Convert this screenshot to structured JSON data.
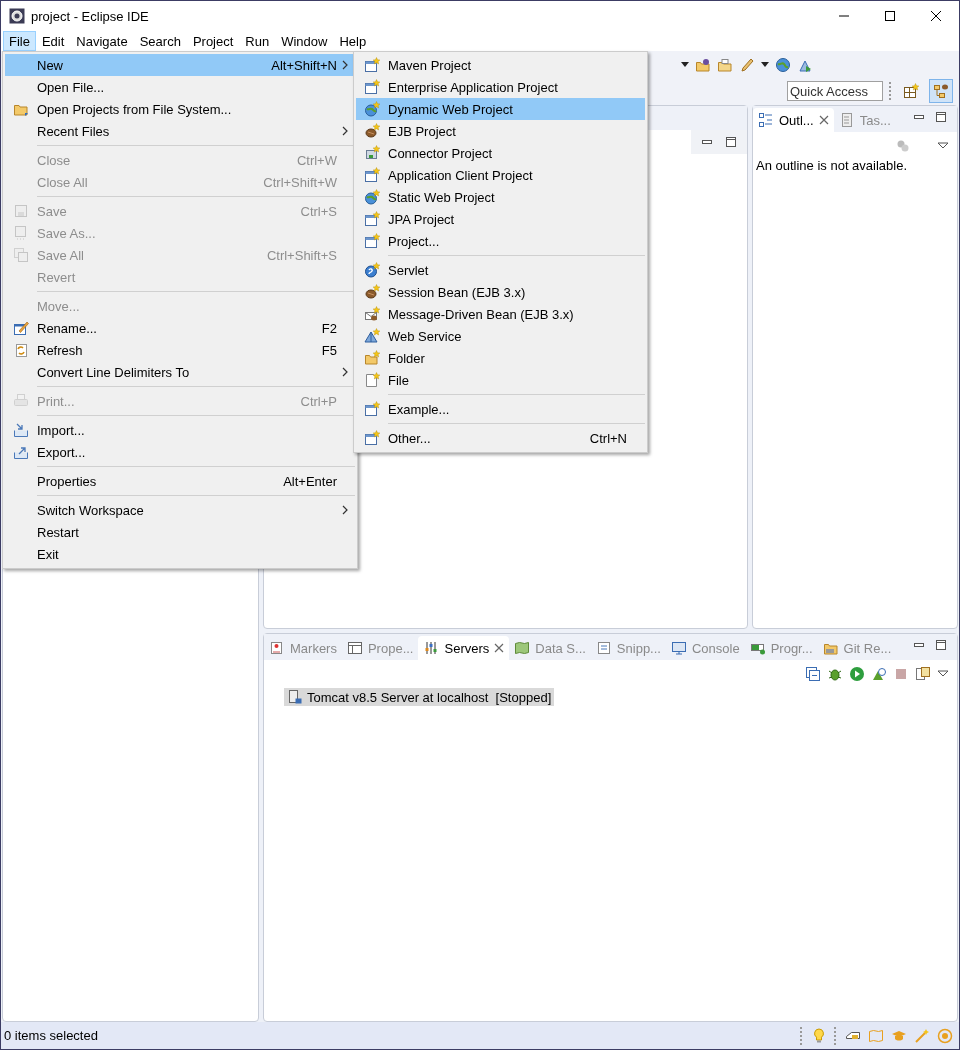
{
  "window": {
    "title": "project - Eclipse IDE"
  },
  "menubar": [
    {
      "label": "File",
      "selected": true
    },
    {
      "label": "Edit",
      "selected": false
    },
    {
      "label": "Navigate",
      "selected": false
    },
    {
      "label": "Search",
      "selected": false
    },
    {
      "label": "Project",
      "selected": false
    },
    {
      "label": "Run",
      "selected": false
    },
    {
      "label": "Window",
      "selected": false
    },
    {
      "label": "Help",
      "selected": false
    }
  ],
  "quick_access": {
    "placeholder": "Quick Access"
  },
  "file_menu": [
    {
      "kind": "item",
      "label": "New",
      "shortcut": "Alt+Shift+N",
      "submenu": true,
      "disabled": false,
      "selected": true
    },
    {
      "kind": "item",
      "label": "Open File...",
      "disabled": false,
      "selected": false
    },
    {
      "kind": "item",
      "label": "Open Projects from File System...",
      "disabled": false,
      "selected": false
    },
    {
      "kind": "item",
      "label": "Recent Files",
      "submenu": true,
      "disabled": false,
      "selected": false
    },
    {
      "kind": "separator"
    },
    {
      "kind": "item",
      "label": "Close",
      "shortcut": "Ctrl+W",
      "disabled": true,
      "selected": false
    },
    {
      "kind": "item",
      "label": "Close All",
      "shortcut": "Ctrl+Shift+W",
      "disabled": true,
      "selected": false
    },
    {
      "kind": "separator"
    },
    {
      "kind": "item",
      "label": "Save",
      "shortcut": "Ctrl+S",
      "disabled": true,
      "selected": false
    },
    {
      "kind": "item",
      "label": "Save As...",
      "disabled": true,
      "selected": false
    },
    {
      "kind": "item",
      "label": "Save All",
      "shortcut": "Ctrl+Shift+S",
      "disabled": true,
      "selected": false
    },
    {
      "kind": "item",
      "label": "Revert",
      "disabled": true,
      "selected": false
    },
    {
      "kind": "separator"
    },
    {
      "kind": "item",
      "label": "Move...",
      "disabled": true,
      "selected": false
    },
    {
      "kind": "item",
      "label": "Rename...",
      "shortcut": "F2",
      "disabled": false,
      "selected": false
    },
    {
      "kind": "item",
      "label": "Refresh",
      "shortcut": "F5",
      "disabled": false,
      "selected": false
    },
    {
      "kind": "item",
      "label": "Convert Line Delimiters To",
      "submenu": true,
      "disabled": false,
      "selected": false
    },
    {
      "kind": "separator"
    },
    {
      "kind": "item",
      "label": "Print...",
      "shortcut": "Ctrl+P",
      "disabled": true,
      "selected": false
    },
    {
      "kind": "separator"
    },
    {
      "kind": "item",
      "label": "Import...",
      "disabled": false,
      "selected": false
    },
    {
      "kind": "item",
      "label": "Export...",
      "disabled": false,
      "selected": false
    },
    {
      "kind": "separator"
    },
    {
      "kind": "item",
      "label": "Properties",
      "shortcut": "Alt+Enter",
      "disabled": false,
      "selected": false
    },
    {
      "kind": "separator"
    },
    {
      "kind": "item",
      "label": "Switch Workspace",
      "submenu": true,
      "disabled": false,
      "selected": false
    },
    {
      "kind": "item",
      "label": "Restart",
      "disabled": false,
      "selected": false
    },
    {
      "kind": "item",
      "label": "Exit",
      "disabled": false,
      "selected": false
    }
  ],
  "new_submenu": [
    {
      "kind": "item",
      "label": "Maven Project",
      "selected": false
    },
    {
      "kind": "item",
      "label": "Enterprise Application Project",
      "selected": false
    },
    {
      "kind": "item",
      "label": "Dynamic Web Project",
      "selected": true
    },
    {
      "kind": "item",
      "label": "EJB Project",
      "selected": false
    },
    {
      "kind": "item",
      "label": "Connector Project",
      "selected": false
    },
    {
      "kind": "item",
      "label": "Application Client Project",
      "selected": false
    },
    {
      "kind": "item",
      "label": "Static Web Project",
      "selected": false
    },
    {
      "kind": "item",
      "label": "JPA Project",
      "selected": false
    },
    {
      "kind": "item",
      "label": "Project...",
      "selected": false
    },
    {
      "kind": "separator"
    },
    {
      "kind": "item",
      "label": "Servlet",
      "selected": false
    },
    {
      "kind": "item",
      "label": "Session Bean (EJB 3.x)",
      "selected": false
    },
    {
      "kind": "item",
      "label": "Message-Driven Bean (EJB 3.x)",
      "selected": false
    },
    {
      "kind": "item",
      "label": "Web Service",
      "selected": false
    },
    {
      "kind": "item",
      "label": "Folder",
      "selected": false
    },
    {
      "kind": "item",
      "label": "File",
      "selected": false
    },
    {
      "kind": "separator"
    },
    {
      "kind": "item",
      "label": "Example...",
      "selected": false
    },
    {
      "kind": "separator"
    },
    {
      "kind": "item",
      "label": "Other...",
      "shortcut": "Ctrl+N",
      "selected": false
    }
  ],
  "outline_panel": {
    "tabs": [
      {
        "label": "Outl...",
        "selected": true
      },
      {
        "label": "Tas...",
        "selected": false
      }
    ],
    "message": "An outline is not available."
  },
  "servers_panel": {
    "tabs": [
      {
        "label": "Markers",
        "selected": false
      },
      {
        "label": "Prope...",
        "selected": false
      },
      {
        "label": "Servers",
        "selected": true
      },
      {
        "label": "Data S...",
        "selected": false
      },
      {
        "label": "Snipp...",
        "selected": false
      },
      {
        "label": "Console",
        "selected": false
      },
      {
        "label": "Progr...",
        "selected": false
      },
      {
        "label": "Git Re...",
        "selected": false
      }
    ],
    "servers": [
      {
        "label": "Tomcat v8.5 Server at localhost  [Stopped]",
        "selected": true
      }
    ]
  },
  "status_bar": {
    "text": "0 items selected"
  }
}
